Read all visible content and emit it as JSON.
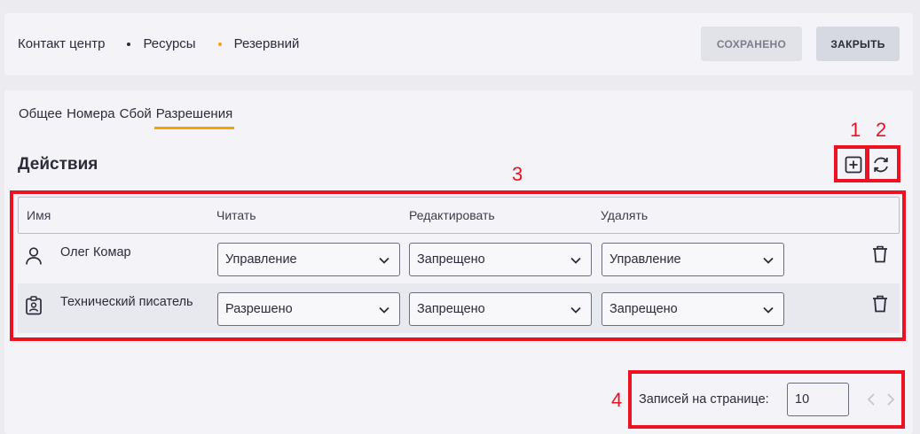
{
  "breadcrumb": {
    "items": [
      "Контакт центр",
      "Ресурсы",
      "Резервний"
    ],
    "dot_colors": [
      "#2b2b3a",
      "#f2a500"
    ]
  },
  "toolbar": {
    "saved_label": "СОХРАНЕНО",
    "close_label": "ЗАКРЫТЬ"
  },
  "tabs": [
    "Общее",
    "Номера",
    "Сбой",
    "Разрешения"
  ],
  "active_tab": "Разрешения",
  "section": {
    "title": "Действия"
  },
  "table": {
    "headers": [
      "Имя",
      "Читать",
      "Редактировать",
      "Удалять"
    ],
    "rows": [
      {
        "icon": "user-icon",
        "name": "Олег Комар",
        "read": "Управление",
        "edit": "Запрещено",
        "delete": "Управление"
      },
      {
        "icon": "badge-icon",
        "name": "Технический писатель",
        "read": "Разрешено",
        "edit": "Запрещено",
        "delete": "Запрещено"
      }
    ]
  },
  "pagination": {
    "label": "Записей на странице:",
    "page_size": "10"
  },
  "annotations": [
    "1",
    "2",
    "3",
    "4"
  ],
  "colors": {
    "accent": "#f2a500",
    "annotation": "#ee1122"
  }
}
